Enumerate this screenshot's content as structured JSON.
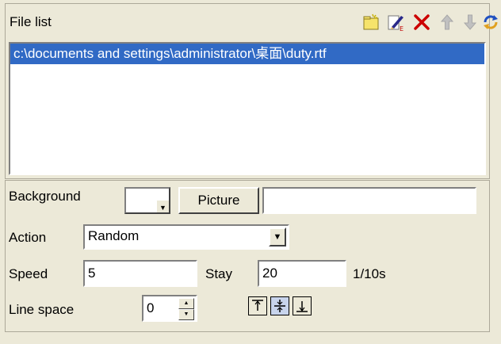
{
  "file_list": {
    "title": "File list",
    "toolbar": {
      "add_icon": "new-folder-icon",
      "edit_icon": "edit-icon",
      "delete_icon": "delete-x-icon",
      "up_icon": "arrow-up-icon",
      "down_icon": "arrow-down-icon",
      "refresh_icon": "swap-refresh-icon"
    },
    "items": [
      "c:\\documents and settings\\administrator\\桌面\\duty.rtf"
    ]
  },
  "settings": {
    "background_label": "Background",
    "background_color": "#ffffff",
    "picture_button": "Picture",
    "picture_value": "",
    "action_label": "Action",
    "action_value": "Random",
    "speed_label": "Speed",
    "speed_value": "5",
    "stay_label": "Stay",
    "stay_value": "20",
    "unit": "1/10s",
    "line_space_label": "Line space",
    "line_space_value": "0",
    "align_icons": [
      "align-top-icon",
      "align-middle-icon",
      "align-bottom-icon"
    ],
    "align_selected": "align-middle-icon"
  },
  "colors": {
    "window_bg": "#ece9d8",
    "selection": "#316ac5",
    "delete_red": "#cc0000"
  }
}
